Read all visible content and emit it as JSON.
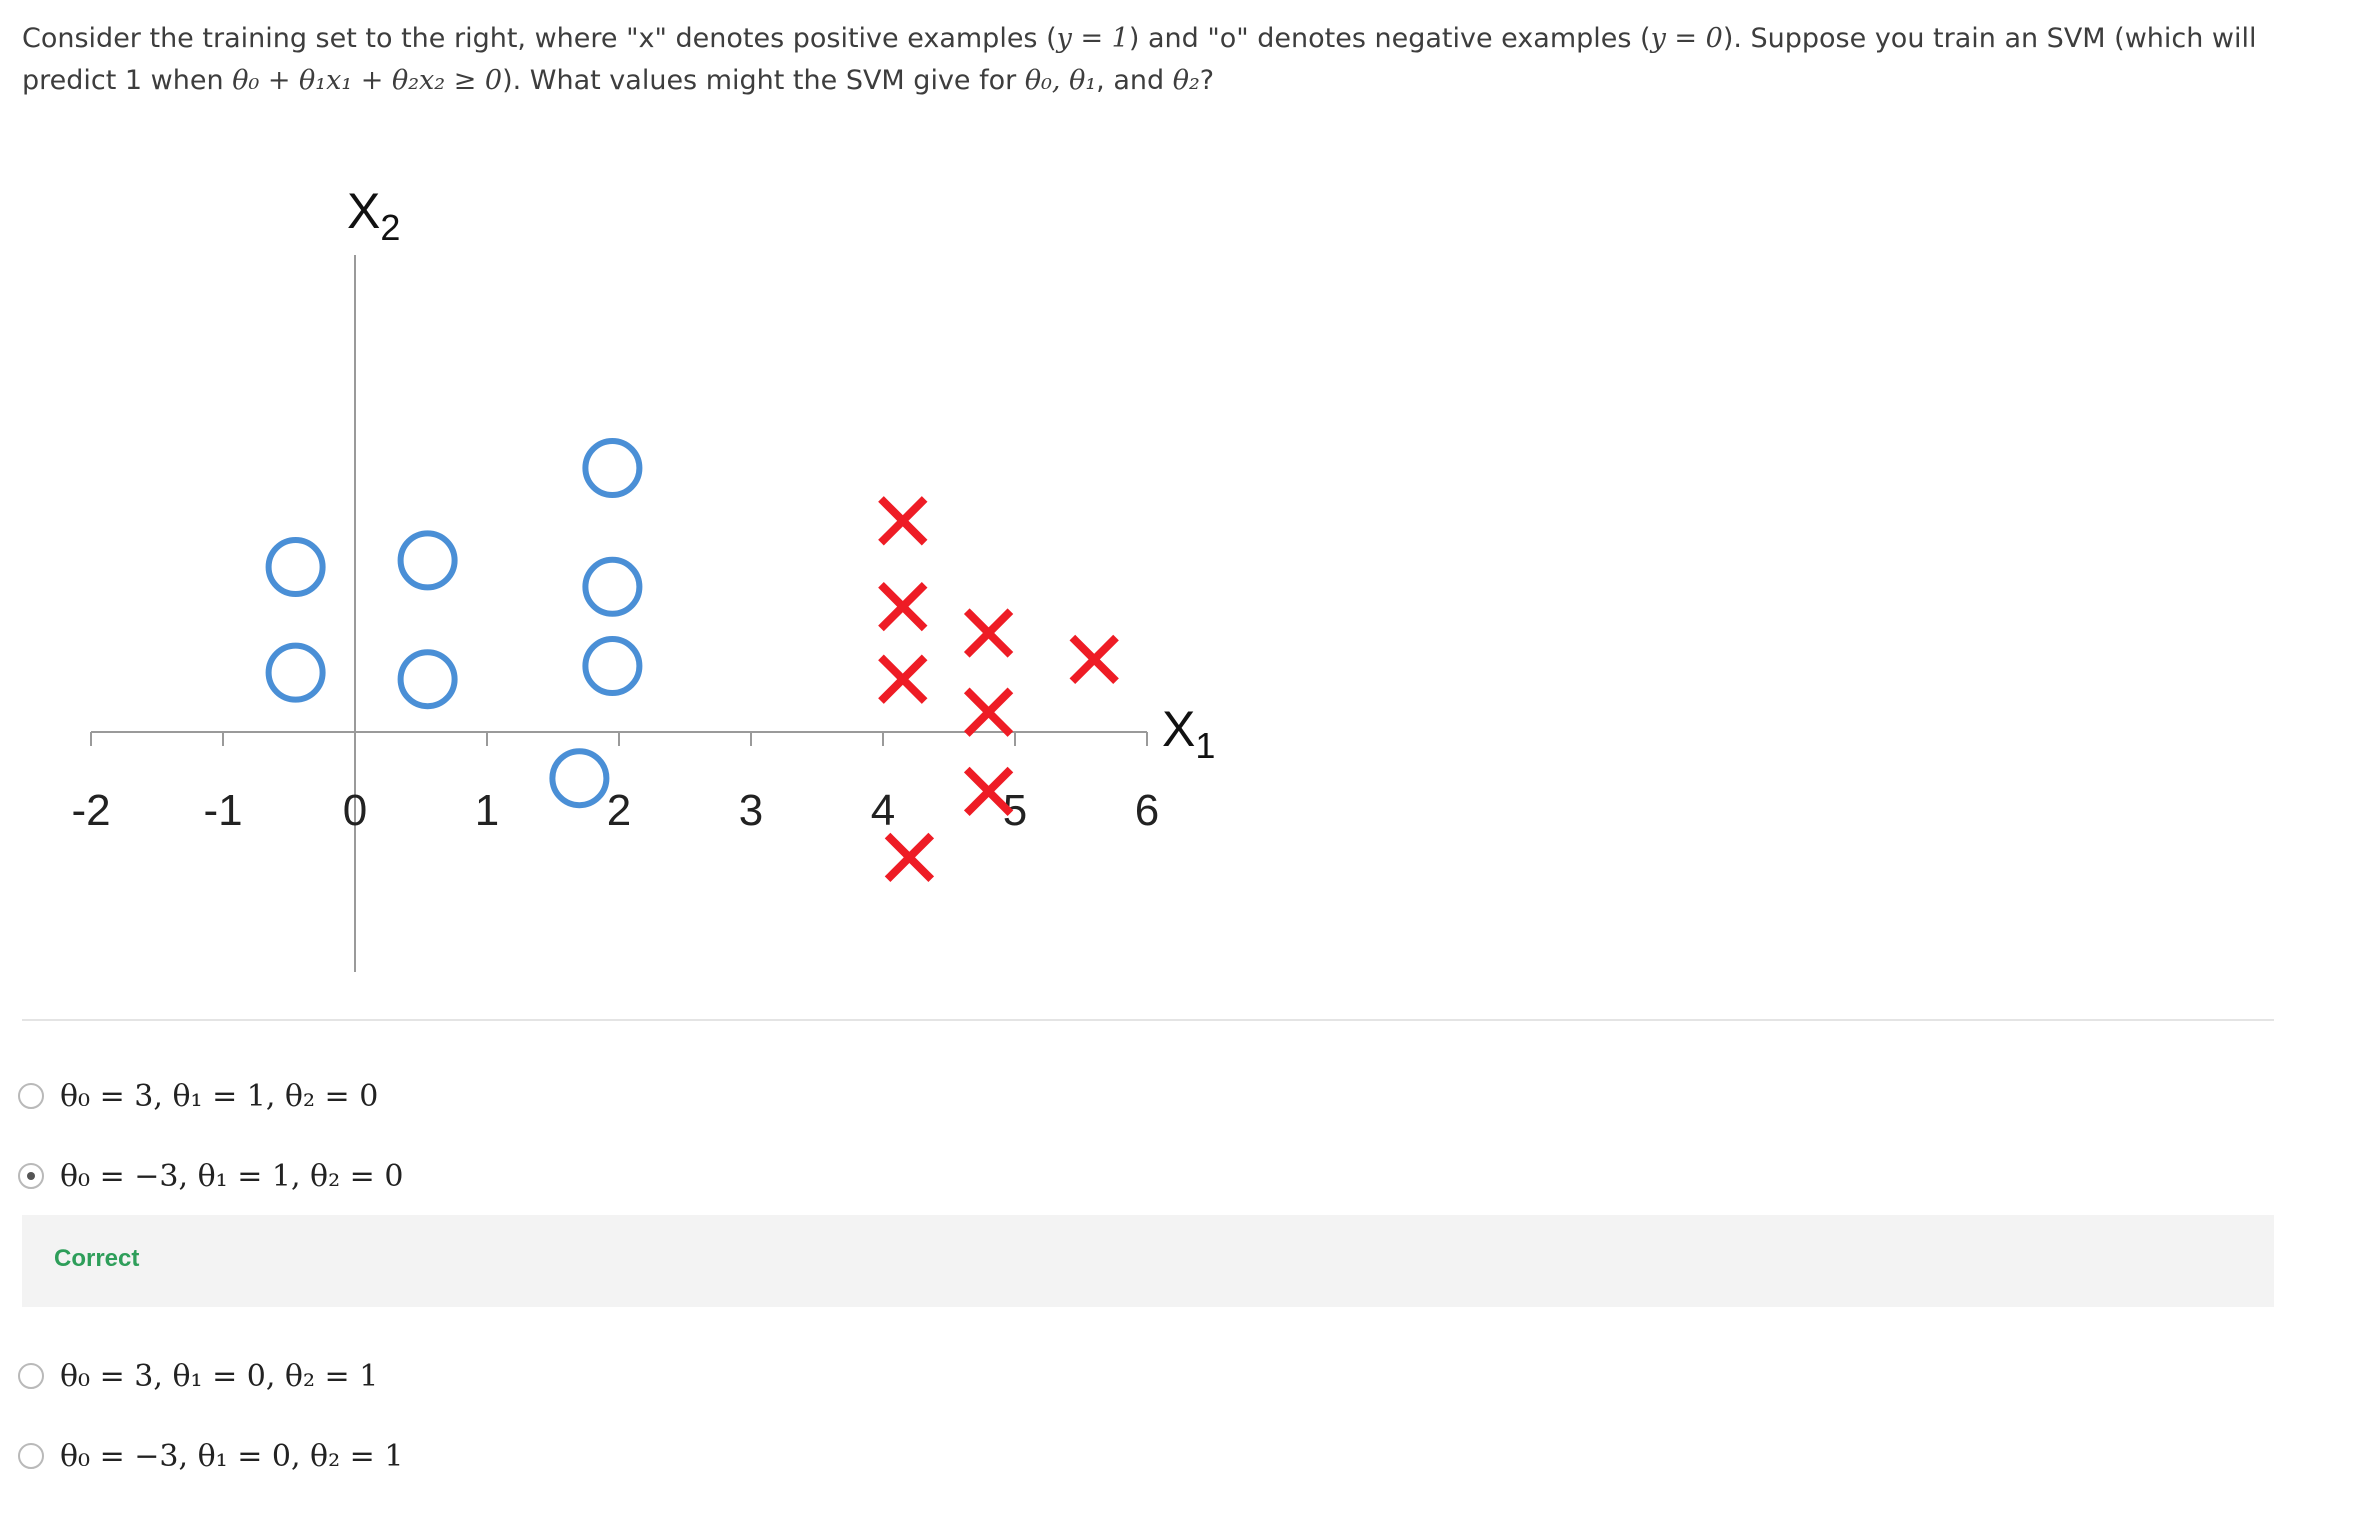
{
  "question": {
    "text_a": "Consider the training set to the right, where \"x\" denotes positive examples (",
    "math_a": "y = 1",
    "text_b": ") and \"o\" denotes negative examples (",
    "math_b": "y = 0",
    "text_c": "). Suppose you train an SVM (which will predict 1 when ",
    "math_c": "θ₀ + θ₁x₁ + θ₂x₂ ≥ 0",
    "text_d": "). What values might the SVM give for ",
    "math_d": "θ₀, θ₁",
    "text_e": ", and ",
    "math_e": "θ₂",
    "text_f": "?"
  },
  "chart_data": {
    "type": "scatter",
    "xlabel": "X1",
    "ylabel": "X2",
    "xticks": [
      "-2",
      "-1",
      "0",
      "1",
      "2",
      "3",
      "4",
      "5",
      "6"
    ],
    "xlim": [
      -2,
      6
    ],
    "series": [
      {
        "marker": "o",
        "color": "#4a8fd6",
        "points": [
          [
            -0.45,
            1.25
          ],
          [
            -0.45,
            0.45
          ],
          [
            0.55,
            1.3
          ],
          [
            0.55,
            0.4
          ],
          [
            1.95,
            2.0
          ],
          [
            1.95,
            1.1
          ],
          [
            1.95,
            0.5
          ],
          [
            1.7,
            -0.35
          ]
        ]
      },
      {
        "marker": "x",
        "color": "#ee1c25",
        "points": [
          [
            4.15,
            1.6
          ],
          [
            4.15,
            0.95
          ],
          [
            4.15,
            0.4
          ],
          [
            4.8,
            0.75
          ],
          [
            4.8,
            0.15
          ],
          [
            4.8,
            -0.45
          ],
          [
            5.6,
            0.55
          ],
          [
            4.2,
            -0.95
          ]
        ]
      }
    ]
  },
  "options": [
    {
      "text": "θ₀ = 3, θ₁ = 1, θ₂ = 0",
      "selected": false
    },
    {
      "text": "θ₀ = −3, θ₁ = 1, θ₂ = 0",
      "selected": true
    },
    {
      "text": "θ₀ = 3, θ₁ = 0, θ₂ = 1",
      "selected": false
    },
    {
      "text": "θ₀ = −3, θ₁ = 0, θ₂ = 1",
      "selected": false
    }
  ],
  "feedback": {
    "label": "Correct",
    "color": "#2e9e5a"
  }
}
